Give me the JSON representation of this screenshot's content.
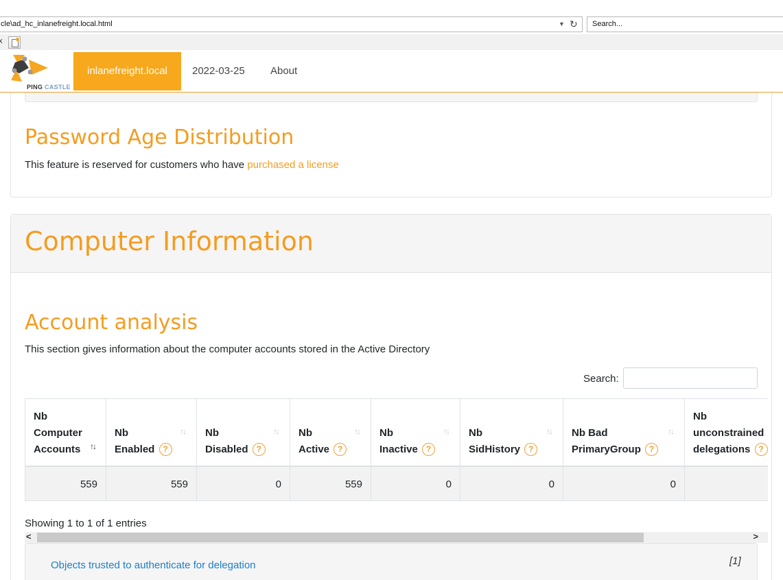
{
  "browser": {
    "address": "cle\\ad_hc_inlanefreight.local.html",
    "search_placeholder": "Search...",
    "tab_close": "x"
  },
  "navbar": {
    "logo_text_a": "PING",
    "logo_text_b": "CASTLE",
    "active_item": "inlanefreight.local",
    "date_item": "2022-03-25",
    "about_item": "About"
  },
  "password_age": {
    "title": "Password Age Distribution",
    "text": "This feature is reserved for customers who have ",
    "link": "purchased a license"
  },
  "computer_info": {
    "title": "Computer Information",
    "subtitle": "Account analysis",
    "description": "This section gives information about the computer accounts stored in the Active Directory",
    "search_label": "Search:",
    "table": {
      "headers": [
        {
          "l1": "Nb",
          "l2": "Computer",
          "l3": "Accounts"
        },
        {
          "l1": "",
          "l2": "Nb",
          "l3": "Enabled"
        },
        {
          "l1": "",
          "l2": "Nb",
          "l3": "Disabled"
        },
        {
          "l1": "",
          "l2": "Nb",
          "l3": "Active"
        },
        {
          "l1": "",
          "l2": "Nb",
          "l3": "Inactive"
        },
        {
          "l1": "",
          "l2": "Nb",
          "l3": "SidHistory"
        },
        {
          "l1": "",
          "l2": "Nb Bad",
          "l3": "PrimaryGroup"
        },
        {
          "l1": "Nb",
          "l2": "unconstrained",
          "l3": "delegations"
        }
      ],
      "row": [
        "559",
        "559",
        "0",
        "559",
        "0",
        "0",
        "0",
        ""
      ]
    },
    "showing": "Showing 1 to 1 of 1 entries",
    "delegation_link": "Objects trusted to authenticate for delegation",
    "delegation_ref": "[1]"
  },
  "colors": {
    "accent": "#f49c1f",
    "link": "#1a7fc8"
  }
}
